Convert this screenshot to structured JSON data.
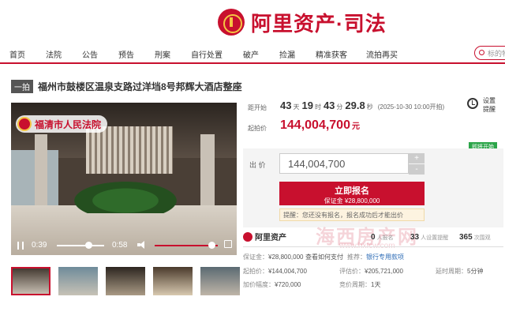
{
  "brand": {
    "name": "阿里资产",
    "dot": "·",
    "sub": "司法"
  },
  "nav": [
    "首页",
    "法院",
    "公告",
    "预告",
    "刑案",
    "自行处置",
    "破产",
    "捡漏",
    "精准获客",
    "流拍再买"
  ],
  "search": {
    "placeholder": "标的物"
  },
  "item": {
    "badge": "一拍",
    "title": "福州市鼓楼区温泉支路过洋垱8号邦辉大酒店整座"
  },
  "video": {
    "court": "福清市人民法院",
    "current_time": "0:39",
    "duration": "0:58",
    "progress": 0.67,
    "volume": 0.9
  },
  "thumbs_count": 5,
  "countdown": {
    "label": "距开始",
    "days": "43",
    "days_unit": "天",
    "hours": "19",
    "hours_unit": "时",
    "minutes": "43",
    "minutes_unit": "分",
    "seconds": "29.8",
    "seconds_unit": "秒",
    "start": "(2025-10-30 10:00开拍)"
  },
  "start_price": {
    "label": "起拍价",
    "value": "144,004,700",
    "unit": "元"
  },
  "reminder": {
    "label": "设置提醒"
  },
  "soon": "即将开始",
  "bid": {
    "label": "出 价",
    "value": "144,004,700",
    "plus": "+",
    "minus": "-",
    "apply_label": "立即报名",
    "deposit_note": "保证金 ¥28,800,000",
    "notice": "提醒：您还没有报名，报名成功后才能出价"
  },
  "platform": {
    "name": "阿里资产",
    "applicants": "0",
    "applicants_unit": "人报名",
    "reminders": "33",
    "reminders_unit": "人设置提醒",
    "views": "365",
    "views_unit": "次围观"
  },
  "watermark": {
    "text": "海西房产网",
    "url": "www.hxfcw.com"
  },
  "details": {
    "deposit_label": "保证金：",
    "deposit": "¥28,800,000",
    "pay_link": "查看如何支付",
    "recommend_label": "推荐：",
    "recommend": "银行专用款项",
    "start_label": "起拍价：",
    "start": "¥144,004,700",
    "eval_label": "评估价：",
    "eval": "¥205,721,000",
    "delay_label": "延时周期：",
    "delay": "5分钟",
    "inc_label": "加价幅度：",
    "inc": "¥720,000",
    "period_label": "竞价周期：",
    "period": "1天"
  }
}
